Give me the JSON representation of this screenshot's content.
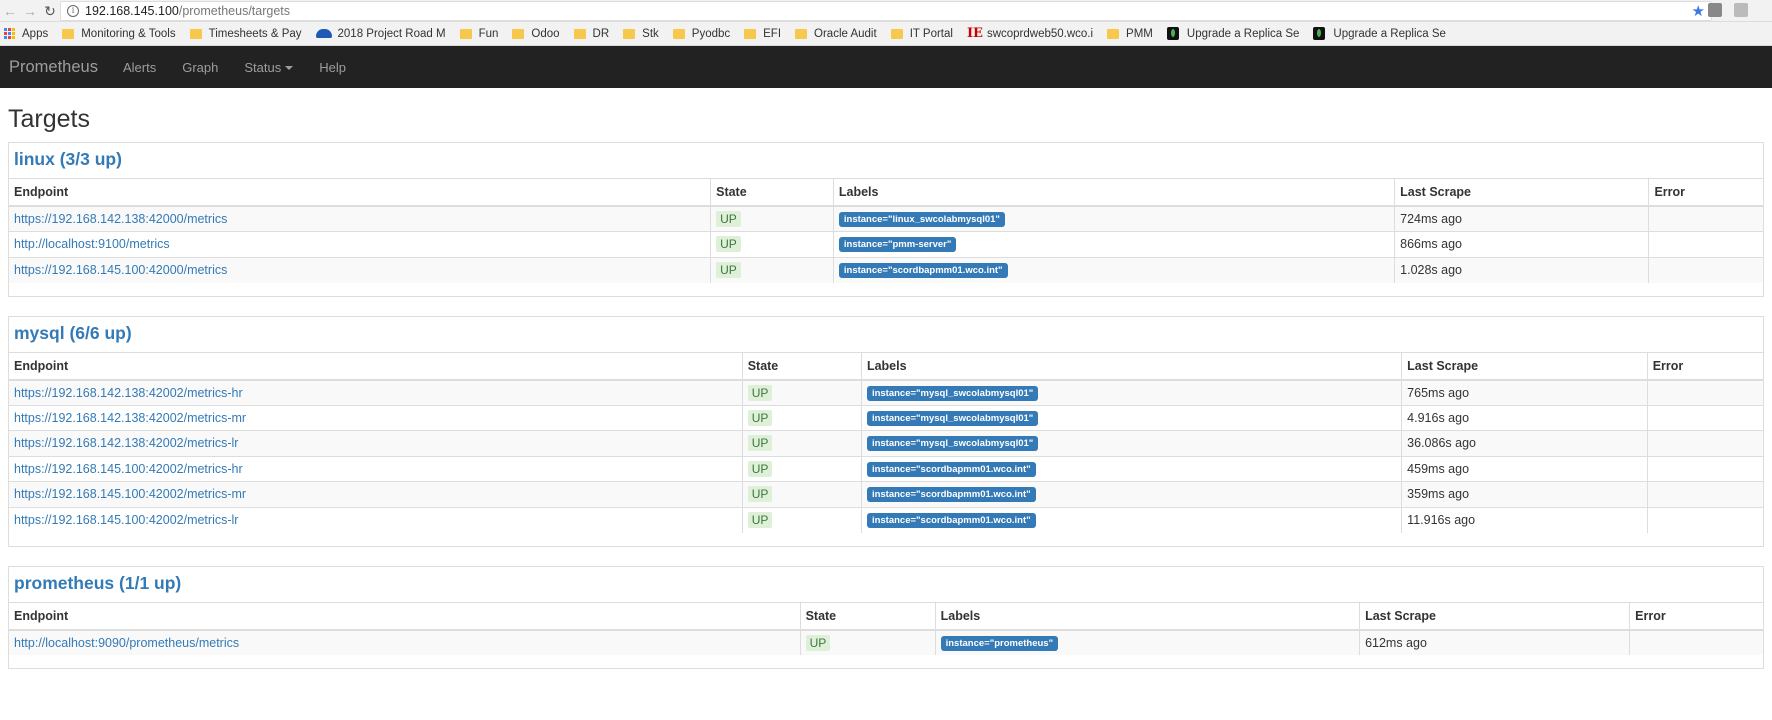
{
  "browser": {
    "url_host": "192.168.145.100",
    "url_path": "/prometheus/targets",
    "bookmarks": [
      {
        "label": "Apps",
        "icon": "apps-icon"
      },
      {
        "label": "Monitoring & Tools",
        "icon": "folder-icon"
      },
      {
        "label": "Timesheets & Pay",
        "icon": "folder-icon"
      },
      {
        "label": "2018 Project Road M",
        "icon": "cloud-icon"
      },
      {
        "label": "Fun",
        "icon": "folder-icon"
      },
      {
        "label": "Odoo",
        "icon": "folder-icon"
      },
      {
        "label": "DR",
        "icon": "folder-icon"
      },
      {
        "label": "Stk",
        "icon": "folder-icon"
      },
      {
        "label": "Pyodbc",
        "icon": "folder-icon"
      },
      {
        "label": "EFI",
        "icon": "folder-icon"
      },
      {
        "label": "Oracle Audit",
        "icon": "folder-icon"
      },
      {
        "label": "IT Portal",
        "icon": "folder-icon"
      },
      {
        "label": "swcoprdweb50.wco.i",
        "icon": "ie-icon"
      },
      {
        "label": "PMM",
        "icon": "folder-icon"
      },
      {
        "label": "Upgrade a Replica Se",
        "icon": "leaf-icon"
      },
      {
        "label": "Upgrade a Replica Se",
        "icon": "leaf-icon"
      }
    ]
  },
  "navbar": {
    "brand": "Prometheus",
    "alerts": "Alerts",
    "graph": "Graph",
    "status": "Status",
    "help": "Help"
  },
  "page": {
    "title": "Targets",
    "columns": [
      "Endpoint",
      "State",
      "Labels",
      "Last Scrape",
      "Error"
    ],
    "jobs": [
      {
        "title": "linux (3/3 up)",
        "rows": [
          {
            "endpoint": "https://192.168.142.138:42000/metrics",
            "state": "UP",
            "label": "instance=\"linux_swcolabmysql01\"",
            "last_scrape": "724ms ago",
            "error": ""
          },
          {
            "endpoint": "http://localhost:9100/metrics",
            "state": "UP",
            "label": "instance=\"pmm-server\"",
            "last_scrape": "866ms ago",
            "error": ""
          },
          {
            "endpoint": "https://192.168.145.100:42000/metrics",
            "state": "UP",
            "label": "instance=\"scordbapmm01.wco.int\"",
            "last_scrape": "1.028s ago",
            "error": ""
          }
        ]
      },
      {
        "title": "mysql (6/6 up)",
        "rows": [
          {
            "endpoint": "https://192.168.142.138:42002/metrics-hr",
            "state": "UP",
            "label": "instance=\"mysql_swcolabmysql01\"",
            "last_scrape": "765ms ago",
            "error": ""
          },
          {
            "endpoint": "https://192.168.142.138:42002/metrics-mr",
            "state": "UP",
            "label": "instance=\"mysql_swcolabmysql01\"",
            "last_scrape": "4.916s ago",
            "error": ""
          },
          {
            "endpoint": "https://192.168.142.138:42002/metrics-lr",
            "state": "UP",
            "label": "instance=\"mysql_swcolabmysql01\"",
            "last_scrape": "36.086s ago",
            "error": ""
          },
          {
            "endpoint": "https://192.168.145.100:42002/metrics-hr",
            "state": "UP",
            "label": "instance=\"scordbapmm01.wco.int\"",
            "last_scrape": "459ms ago",
            "error": ""
          },
          {
            "endpoint": "https://192.168.145.100:42002/metrics-mr",
            "state": "UP",
            "label": "instance=\"scordbapmm01.wco.int\"",
            "last_scrape": "359ms ago",
            "error": ""
          },
          {
            "endpoint": "https://192.168.145.100:42002/metrics-lr",
            "state": "UP",
            "label": "instance=\"scordbapmm01.wco.int\"",
            "last_scrape": "11.916s ago",
            "error": ""
          }
        ]
      },
      {
        "title": "prometheus (1/1 up)",
        "rows": [
          {
            "endpoint": "http://localhost:9090/prometheus/metrics",
            "state": "UP",
            "label": "instance=\"prometheus\"",
            "last_scrape": "612ms ago",
            "error": ""
          }
        ]
      }
    ]
  }
}
